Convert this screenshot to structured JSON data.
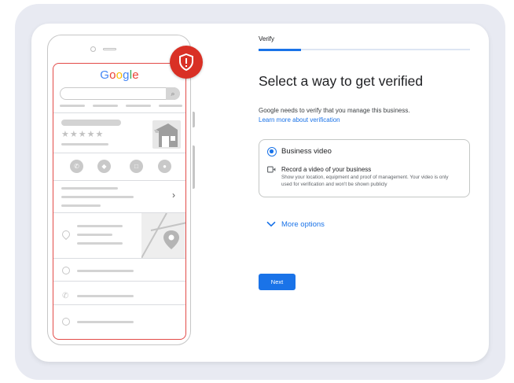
{
  "phone_mockup": {
    "logo_text": "Google",
    "stars": "★★★★★"
  },
  "verify": {
    "step_label": "Verify",
    "progress": 0.2,
    "title": "Select a way to get verified",
    "description": "Google needs to verify that you manage this business.",
    "learn_more": "Learn more about verification",
    "option": {
      "label": "Business video",
      "detail_title": "Record a video of your business",
      "detail_text": "Show your location, equipment and proof of management. Your video is only used for verification and won't be shown publicly"
    },
    "more_options": "More options",
    "next_button": "Next"
  },
  "colors": {
    "accent": "#1a73e8",
    "alert_red": "#d93025",
    "frame_bg": "#e8eaf2"
  },
  "icons": [
    "shield-alert-icon",
    "search-icon",
    "phone-icon",
    "directions-icon",
    "bookmark-icon",
    "website-icon",
    "location-pin-icon",
    "clock-icon",
    "video-icon",
    "chevron-down-icon",
    "chevron-right-icon"
  ]
}
